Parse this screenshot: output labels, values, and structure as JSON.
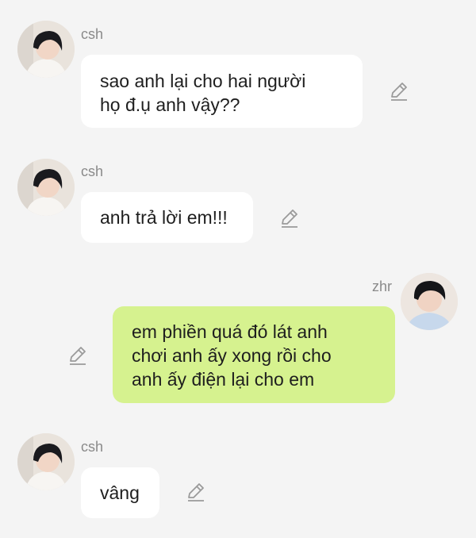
{
  "icons": {
    "avatar": "avatar-photo",
    "edit": "pencil-edit-icon"
  },
  "colors": {
    "background": "#f4f4f4",
    "incoming_bubble": "#ffffff",
    "outgoing_bubble": "#d6f28f",
    "sender_name": "#8a8a8a",
    "message_text": "#1e1e1e",
    "edit_icon": "#9a9a9a"
  },
  "messages": [
    {
      "sender": "csh",
      "direction": "incoming",
      "lines": [
        "sao anh lại cho hai người",
        "họ đ.ụ anh vậy??"
      ]
    },
    {
      "sender": "csh",
      "direction": "incoming",
      "lines": [
        "anh trả lời em!!!"
      ]
    },
    {
      "sender": "zhr",
      "direction": "outgoing",
      "lines": [
        "em phiền quá đó lát anh",
        "chơi anh ấy xong rồi cho",
        "anh ấy điện lại cho em"
      ]
    },
    {
      "sender": "csh",
      "direction": "incoming",
      "lines": [
        "vâng"
      ]
    }
  ]
}
